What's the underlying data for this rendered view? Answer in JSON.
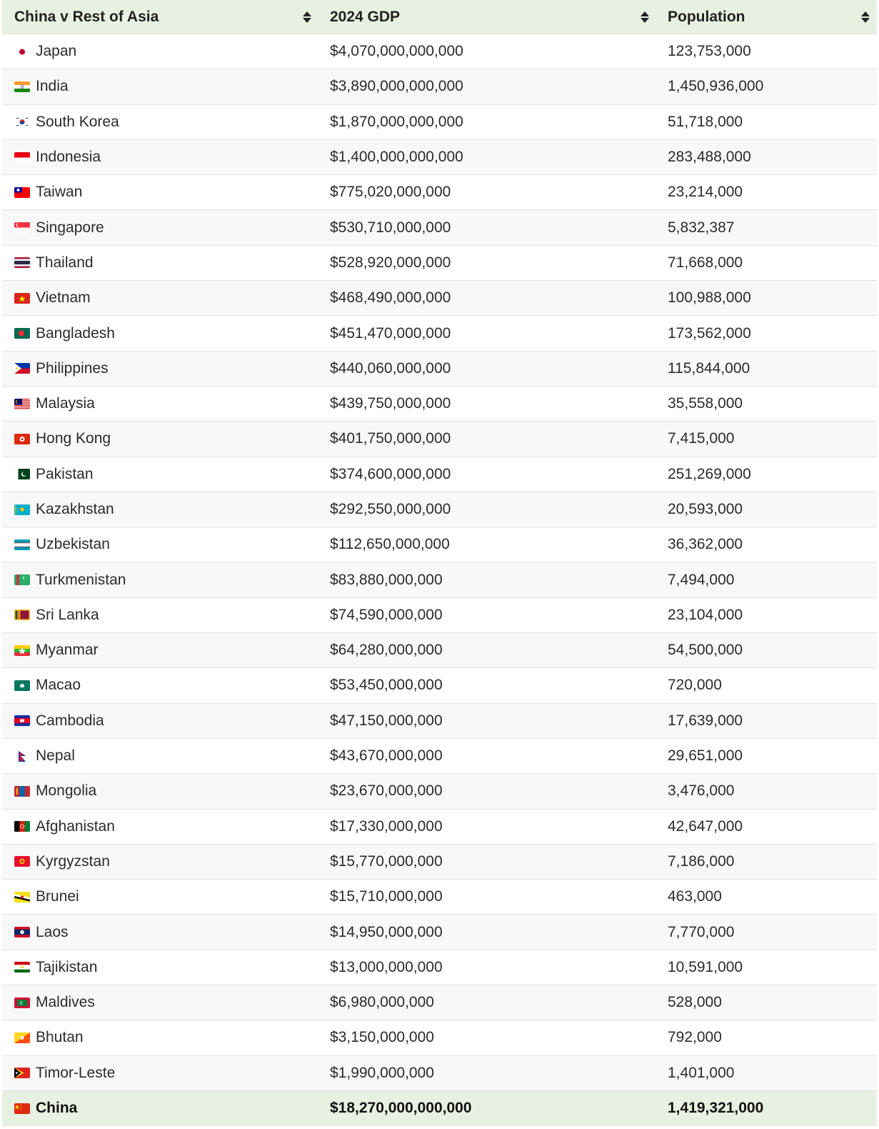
{
  "table": {
    "headers": [
      "China v Rest of Asia",
      "2024 GDP",
      "Population"
    ],
    "rows": [
      {
        "country": "Japan",
        "flag": "flag-japan",
        "gdp": "$4,070,000,000,000",
        "population": "123,753,000"
      },
      {
        "country": "India",
        "flag": "flag-india",
        "gdp": "$3,890,000,000,000",
        "population": "1,450,936,000"
      },
      {
        "country": "South Korea",
        "flag": "flag-south-korea",
        "gdp": "$1,870,000,000,000",
        "population": "51,718,000"
      },
      {
        "country": "Indonesia",
        "flag": "flag-indonesia",
        "gdp": "$1,400,000,000,000",
        "population": "283,488,000"
      },
      {
        "country": "Taiwan",
        "flag": "flag-taiwan",
        "gdp": "$775,020,000,000",
        "population": "23,214,000"
      },
      {
        "country": "Singapore",
        "flag": "flag-singapore",
        "gdp": "$530,710,000,000",
        "population": "5,832,387"
      },
      {
        "country": "Thailand",
        "flag": "flag-thailand",
        "gdp": "$528,920,000,000",
        "population": "71,668,000"
      },
      {
        "country": "Vietnam",
        "flag": "flag-vietnam",
        "gdp": "$468,490,000,000",
        "population": "100,988,000"
      },
      {
        "country": "Bangladesh",
        "flag": "flag-bangladesh",
        "gdp": "$451,470,000,000",
        "population": "173,562,000"
      },
      {
        "country": "Philippines",
        "flag": "flag-philippines",
        "gdp": "$440,060,000,000",
        "population": "115,844,000"
      },
      {
        "country": "Malaysia",
        "flag": "flag-malaysia",
        "gdp": "$439,750,000,000",
        "population": "35,558,000"
      },
      {
        "country": "Hong Kong",
        "flag": "flag-hong-kong",
        "gdp": "$401,750,000,000",
        "population": "7,415,000"
      },
      {
        "country": "Pakistan",
        "flag": "flag-pakistan",
        "gdp": "$374,600,000,000",
        "population": "251,269,000"
      },
      {
        "country": "Kazakhstan",
        "flag": "flag-kazakhstan",
        "gdp": "$292,550,000,000",
        "population": "20,593,000"
      },
      {
        "country": "Uzbekistan",
        "flag": "flag-uzbekistan",
        "gdp": "$112,650,000,000",
        "population": "36,362,000"
      },
      {
        "country": "Turkmenistan",
        "flag": "flag-turkmenistan",
        "gdp": "$83,880,000,000",
        "population": "7,494,000"
      },
      {
        "country": "Sri Lanka",
        "flag": "flag-sri-lanka",
        "gdp": "$74,590,000,000",
        "population": "23,104,000"
      },
      {
        "country": "Myanmar",
        "flag": "flag-myanmar",
        "gdp": "$64,280,000,000",
        "population": "54,500,000"
      },
      {
        "country": "Macao",
        "flag": "flag-macao",
        "gdp": "$53,450,000,000",
        "population": "720,000"
      },
      {
        "country": "Cambodia",
        "flag": "flag-cambodia",
        "gdp": "$47,150,000,000",
        "population": "17,639,000"
      },
      {
        "country": "Nepal",
        "flag": "flag-nepal",
        "gdp": "$43,670,000,000",
        "population": "29,651,000"
      },
      {
        "country": "Mongolia",
        "flag": "flag-mongolia",
        "gdp": "$23,670,000,000",
        "population": "3,476,000"
      },
      {
        "country": "Afghanistan",
        "flag": "flag-afghanistan",
        "gdp": "$17,330,000,000",
        "population": "42,647,000"
      },
      {
        "country": "Kyrgyzstan",
        "flag": "flag-kyrgyzstan",
        "gdp": "$15,770,000,000",
        "population": "7,186,000"
      },
      {
        "country": "Brunei",
        "flag": "flag-brunei",
        "gdp": "$15,710,000,000",
        "population": "463,000"
      },
      {
        "country": "Laos",
        "flag": "flag-laos",
        "gdp": "$14,950,000,000",
        "population": "7,770,000"
      },
      {
        "country": "Tajikistan",
        "flag": "flag-tajikistan",
        "gdp": "$13,000,000,000",
        "population": "10,591,000"
      },
      {
        "country": "Maldives",
        "flag": "flag-maldives",
        "gdp": "$6,980,000,000",
        "population": "528,000"
      },
      {
        "country": "Bhutan",
        "flag": "flag-bhutan",
        "gdp": "$3,150,000,000",
        "population": "792,000"
      },
      {
        "country": "Timor-Leste",
        "flag": "flag-timor-leste",
        "gdp": "$1,990,000,000",
        "population": "1,401,000"
      }
    ],
    "footer": {
      "country": "China",
      "flag": "flag-china",
      "gdp": "$18,270,000,000,000",
      "population": "1,419,321,000"
    }
  },
  "colors": {
    "header_bg": "#e8f1e1",
    "row_alt": "#f8f8f8",
    "border": "#e2e2e2"
  }
}
